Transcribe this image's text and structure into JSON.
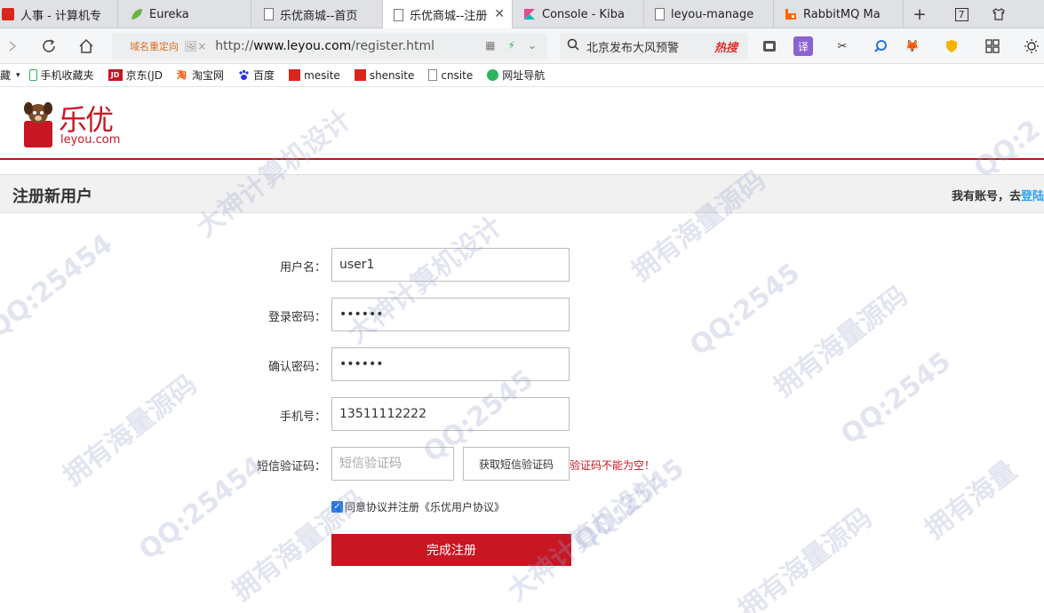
{
  "browser": {
    "tabs": [
      {
        "label": "人事 - 计算机专",
        "icon": "red-page-icon",
        "active": false
      },
      {
        "label": "Eureka",
        "icon": "leaf-icon",
        "active": false
      },
      {
        "label": "乐优商城--首页",
        "icon": "page-icon",
        "active": false
      },
      {
        "label": "乐优商城--注册",
        "icon": "page-icon",
        "active": true
      },
      {
        "label": "Console - Kiba",
        "icon": "kibana-icon",
        "active": false
      },
      {
        "label": "leyou-manage",
        "icon": "page-icon",
        "active": false
      },
      {
        "label": "RabbitMQ Ma",
        "icon": "rabbitmq-icon",
        "active": false
      }
    ],
    "tab_count": "7",
    "address": {
      "redirect_text": "域名重定向",
      "noimg_text": "🖼×",
      "url_prefix": "http://",
      "url_host": "www.leyou.com",
      "url_path": "/register.html"
    },
    "search_text": "北京发布大风预警",
    "hot_search": "热搜",
    "translate_label": "译",
    "bookmarks": [
      {
        "label": "收藏",
        "icon": "star-icon"
      },
      {
        "label": "手机收藏夹",
        "icon": "phone-icon"
      },
      {
        "label": "京东(JD",
        "icon": "jd-icon"
      },
      {
        "label": "淘宝网",
        "icon": "taobao-icon"
      },
      {
        "label": "百度",
        "icon": "baidu-icon"
      },
      {
        "label": "mesite",
        "icon": "red-page-icon"
      },
      {
        "label": "shensite",
        "icon": "red-page-icon"
      },
      {
        "label": "cnsite",
        "icon": "page-icon"
      },
      {
        "label": "网址导航",
        "icon": "navigation-icon"
      }
    ]
  },
  "page": {
    "logo_text": "乐优",
    "logo_domain": "leyou.com",
    "title": "注册新用户",
    "have_account": "我有账号，去",
    "login_link": "登陆",
    "colors": {
      "brand_red": "#c81623",
      "link_blue": "#28a3ef",
      "header_line": "#b1191a"
    },
    "form": {
      "username_label": "用户名：",
      "username_value": "user1",
      "password_label": "登录密码：",
      "password_value": "123456",
      "confirm_label": "确认密码：",
      "confirm_value": "123456",
      "phone_label": "手机号：",
      "phone_value": "13511112222",
      "sms_label": "短信验证码：",
      "sms_placeholder": "短信验证码",
      "get_code_button": "获取短信验证码",
      "sms_error": "验证码不能为空！",
      "agree_text": "同意协议并注册《乐优用户协议》",
      "agree_checked": true,
      "submit_button": "完成注册"
    }
  }
}
